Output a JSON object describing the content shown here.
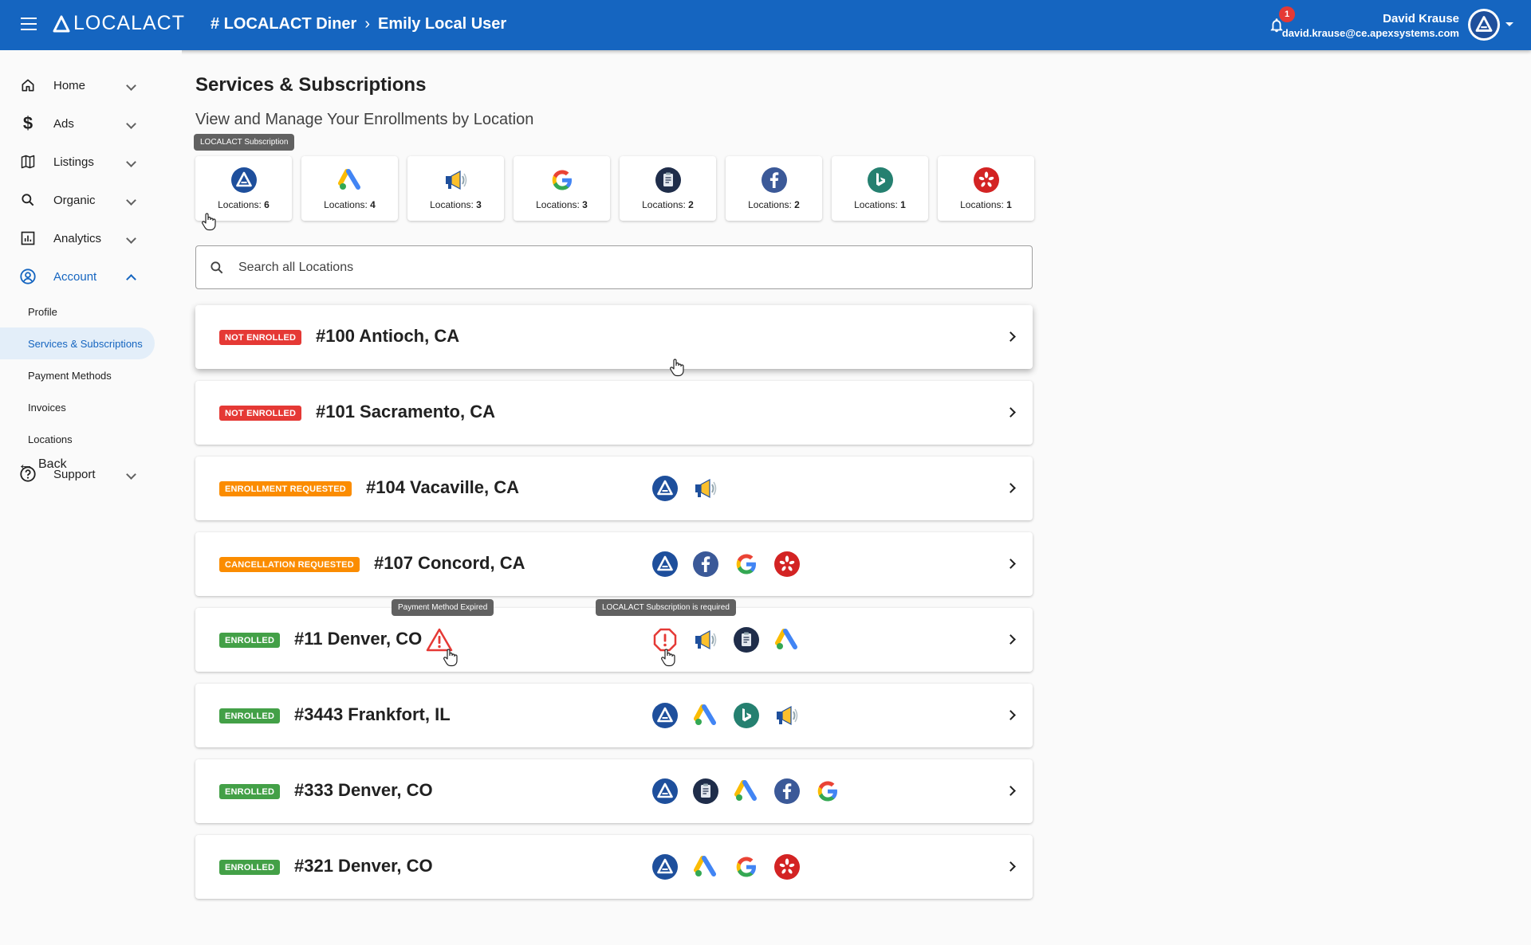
{
  "app": {
    "logo_text": "LOCALACT",
    "breadcrumb": [
      "# LOCALACT Diner",
      "Emily Local User"
    ],
    "notification_count": "1",
    "user_name": "David Krause",
    "user_email": "david.krause@ce.apexsystems.com",
    "brand_color": "#1565c0"
  },
  "sidebar": {
    "items": [
      {
        "label": "Home",
        "icon": "home-icon"
      },
      {
        "label": "Ads",
        "icon": "dollar-icon"
      },
      {
        "label": "Listings",
        "icon": "map-icon"
      },
      {
        "label": "Organic",
        "icon": "search-icon"
      },
      {
        "label": "Analytics",
        "icon": "analytics-icon"
      },
      {
        "label": "Account",
        "icon": "account-icon"
      }
    ],
    "account_sub": [
      "Profile",
      "Services & Subscriptions",
      "Payment Methods",
      "Invoices",
      "Locations"
    ],
    "support_label": "Support",
    "back_label": "Back"
  },
  "main": {
    "title": "Services & Subscriptions",
    "subtitle": "View and Manage Your Enrollments by Location",
    "services_tooltip": "LOCALACT Subscription",
    "services": [
      {
        "icon": "localact-icon",
        "prefix": "Locations: ",
        "count": "6"
      },
      {
        "icon": "google-ads-icon",
        "prefix": "Locations: ",
        "count": "4"
      },
      {
        "icon": "megaphone-icon",
        "prefix": "Locations: ",
        "count": "3"
      },
      {
        "icon": "google-icon",
        "prefix": "Locations: ",
        "count": "3"
      },
      {
        "icon": "clipboard-icon",
        "prefix": "Locations: ",
        "count": "2"
      },
      {
        "icon": "facebook-icon",
        "prefix": "Locations: ",
        "count": "2"
      },
      {
        "icon": "bing-icon",
        "prefix": "Locations: ",
        "count": "1"
      },
      {
        "icon": "yelp-icon",
        "prefix": "Locations: ",
        "count": "1"
      }
    ],
    "search_placeholder": "Search all Locations",
    "warning_tooltip": "Payment Method Expired",
    "required_tooltip": "LOCALACT Subscription is required",
    "locations": [
      {
        "status": "NOT ENROLLED",
        "status_color": "#e53935",
        "name": "#100 Antioch, CA",
        "icons": []
      },
      {
        "status": "NOT ENROLLED",
        "status_color": "#e53935",
        "name": "#101 Sacramento, CA",
        "icons": []
      },
      {
        "status": "ENROLLMENT REQUESTED",
        "status_color": "#fb8c00",
        "name": "#104 Vacaville, CA",
        "icons": [
          "localact-icon",
          "megaphone-icon"
        ]
      },
      {
        "status": "CANCELLATION REQUESTED",
        "status_color": "#fb8c00",
        "name": "#107 Concord, CA",
        "icons": [
          "localact-icon",
          "facebook-icon",
          "google-icon",
          "yelp-icon"
        ]
      },
      {
        "status": "ENROLLED",
        "status_color": "#43a047",
        "name": "#11 Denver, CO",
        "icons": [
          "alert-octagon-icon",
          "megaphone-icon",
          "clipboard-icon",
          "google-ads-icon"
        ]
      },
      {
        "status": "ENROLLED",
        "status_color": "#43a047",
        "name": "#3443 Frankfort, IL",
        "icons": [
          "localact-icon",
          "google-ads-icon",
          "bing-icon",
          "megaphone-icon"
        ]
      },
      {
        "status": "ENROLLED",
        "status_color": "#43a047",
        "name": "#333 Denver, CO",
        "icons": [
          "localact-icon",
          "clipboard-icon",
          "google-ads-icon",
          "facebook-icon",
          "google-icon"
        ]
      },
      {
        "status": "ENROLLED",
        "status_color": "#43a047",
        "name": "#321 Denver, CO",
        "icons": [
          "localact-icon",
          "google-ads-icon",
          "google-icon",
          "yelp-icon"
        ]
      }
    ]
  }
}
